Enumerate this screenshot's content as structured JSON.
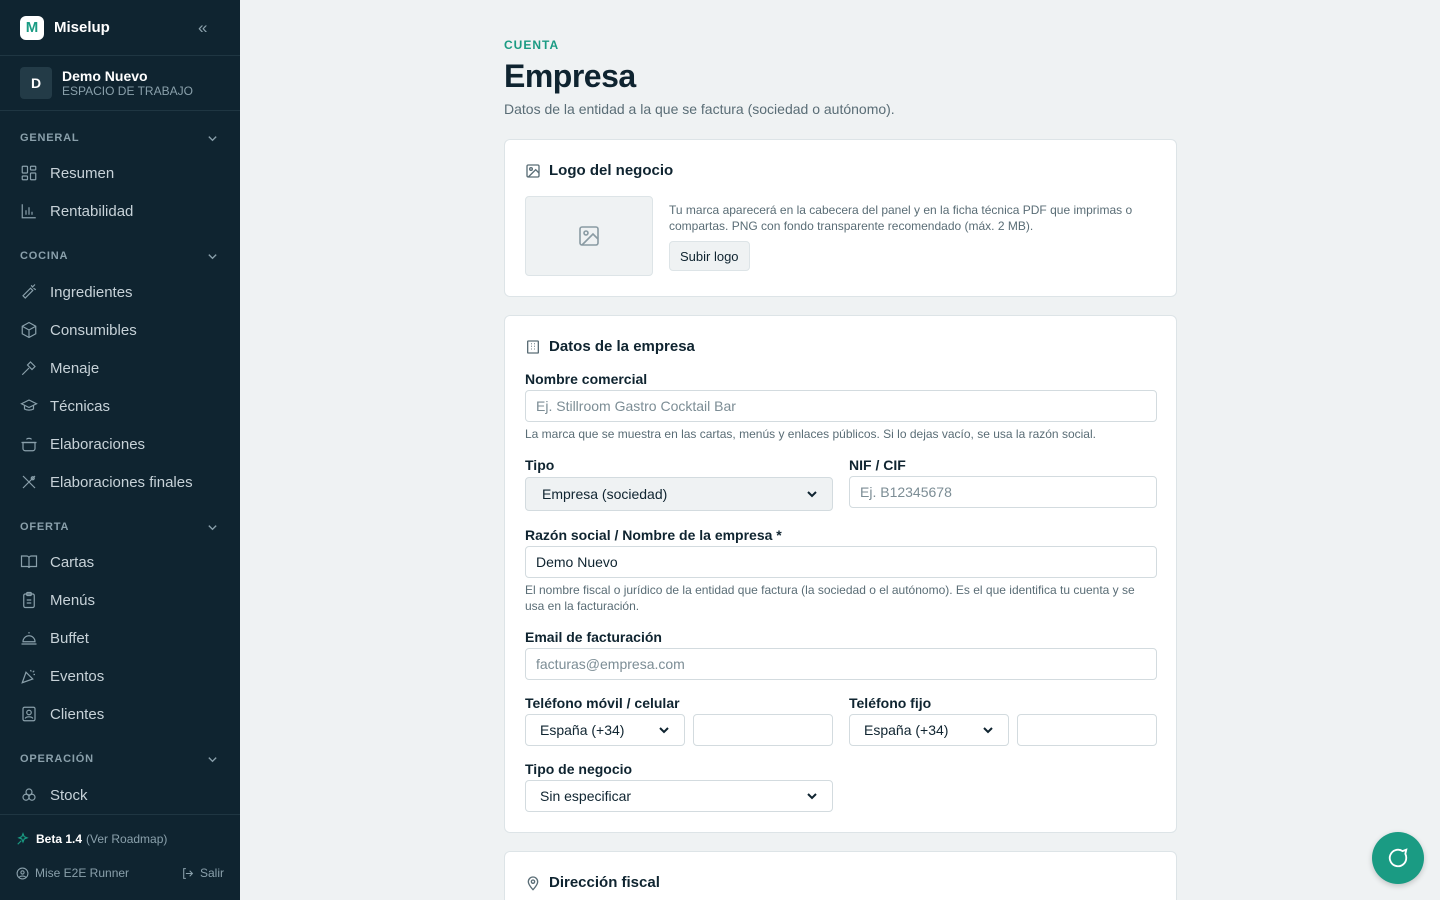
{
  "app": {
    "brand_letter": "M",
    "brand_name": "Miselup"
  },
  "workspace": {
    "initial": "D",
    "name": "Demo Nuevo",
    "subtitle": "ESPACIO DE TRABAJO"
  },
  "sidebar": {
    "sections": [
      {
        "label": "GENERAL",
        "items": [
          {
            "label": "Resumen",
            "icon": "grid-icon"
          },
          {
            "label": "Rentabilidad",
            "icon": "bar-chart-icon"
          }
        ]
      },
      {
        "label": "COCINA",
        "items": [
          {
            "label": "Ingredientes",
            "icon": "carrot-icon"
          },
          {
            "label": "Consumibles",
            "icon": "box-icon"
          },
          {
            "label": "Menaje",
            "icon": "utensils-icon"
          },
          {
            "label": "Técnicas",
            "icon": "cap-icon"
          },
          {
            "label": "Elaboraciones",
            "icon": "pot-icon"
          },
          {
            "label": "Elaboraciones finales",
            "icon": "cross-utensils-icon"
          }
        ]
      },
      {
        "label": "OFERTA",
        "items": [
          {
            "label": "Cartas",
            "icon": "book-icon"
          },
          {
            "label": "Menús",
            "icon": "clipboard-icon"
          },
          {
            "label": "Buffet",
            "icon": "cloche-icon"
          },
          {
            "label": "Eventos",
            "icon": "party-icon"
          },
          {
            "label": "Clientes",
            "icon": "contact-icon"
          }
        ]
      },
      {
        "label": "OPERACIÓN",
        "items": [
          {
            "label": "Stock",
            "icon": "boxes-icon"
          }
        ]
      }
    ],
    "footer": {
      "beta": "Beta 1.4",
      "roadmap": "(Ver Roadmap)",
      "user": "Mise E2E Runner",
      "logout": "Salir"
    }
  },
  "page": {
    "eyebrow": "CUENTA",
    "title": "Empresa",
    "description": "Datos de la entidad a la que se factura (sociedad o autónomo)."
  },
  "logo_card": {
    "title": "Logo del negocio",
    "help": "Tu marca aparecerá en la cabecera del panel y en la ficha técnica PDF que imprimas o compartas. PNG con fondo transparente recomendado (máx. 2 MB).",
    "upload_label": "Subir logo"
  },
  "company_card": {
    "title": "Datos de la empresa",
    "trade_name": {
      "label": "Nombre comercial",
      "placeholder": "Ej. Stillroom Gastro Cocktail Bar",
      "value": "",
      "help": "La marca que se muestra en las cartas, menús y enlaces públicos. Si lo dejas vacío, se usa la razón social."
    },
    "type": {
      "label": "Tipo",
      "value": "Empresa (sociedad)"
    },
    "tax_id": {
      "label": "NIF / CIF",
      "placeholder": "Ej. B12345678",
      "value": ""
    },
    "legal_name": {
      "label": "Razón social / Nombre de la empresa *",
      "value": "Demo Nuevo",
      "help": "El nombre fiscal o jurídico de la entidad que factura (la sociedad o el autónomo). Es el que identifica tu cuenta y se usa en la facturación."
    },
    "billing_email": {
      "label": "Email de facturación",
      "placeholder": "facturas@empresa.com",
      "value": ""
    },
    "mobile": {
      "label": "Teléfono móvil / celular",
      "country": "España (+34)",
      "value": ""
    },
    "landline": {
      "label": "Teléfono fijo",
      "country": "España (+34)",
      "value": ""
    },
    "business_type": {
      "label": "Tipo de negocio",
      "value": "Sin especificar"
    }
  },
  "address_card": {
    "title": "Dirección fiscal"
  },
  "colors": {
    "sidebar_bg": "#0f2430",
    "accent": "#1a9b83",
    "page_bg": "#eff2f3"
  }
}
